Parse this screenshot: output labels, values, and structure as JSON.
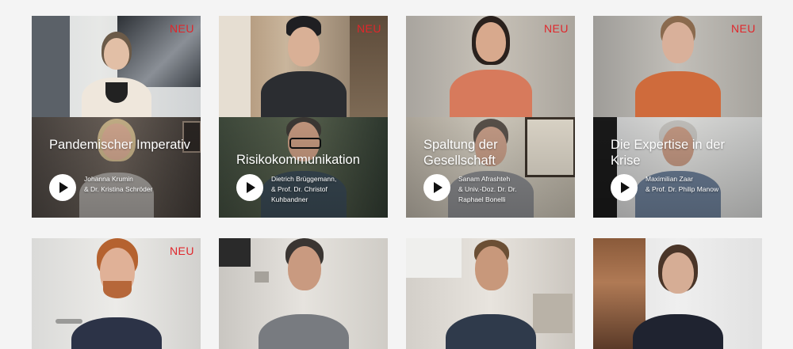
{
  "cards": [
    {
      "badge": "NEU",
      "title": "Pandemischer Imperativ",
      "names": [
        "Johanna Krumin",
        "& Dr. Kristina Schröder"
      ]
    },
    {
      "badge": "NEU",
      "title": "Risikokommunikation",
      "names": [
        "Dietrich Brüggemann,",
        "& Prof. Dr. Christof",
        "Kuhbandner"
      ]
    },
    {
      "badge": "NEU",
      "title": "Spaltung der Gesellschaft",
      "names": [
        "Sanam Afrashteh",
        "& Univ.-Doz. Dr. Dr.",
        "Raphael Bonelli"
      ]
    },
    {
      "badge": "NEU",
      "title": "Die Expertise in der Krise",
      "names": [
        "Maximilian Zaar",
        "& Prof. Dr. Philip Manow"
      ]
    }
  ],
  "second_row": [
    {
      "badge": "NEU"
    },
    {
      "badge": ""
    },
    {
      "badge": ""
    },
    {
      "badge": ""
    }
  ],
  "colors": {
    "badge": "#e0262b",
    "background": "#f4f4f4",
    "title": "#ffffff"
  },
  "icons": {
    "play": "play-icon"
  }
}
